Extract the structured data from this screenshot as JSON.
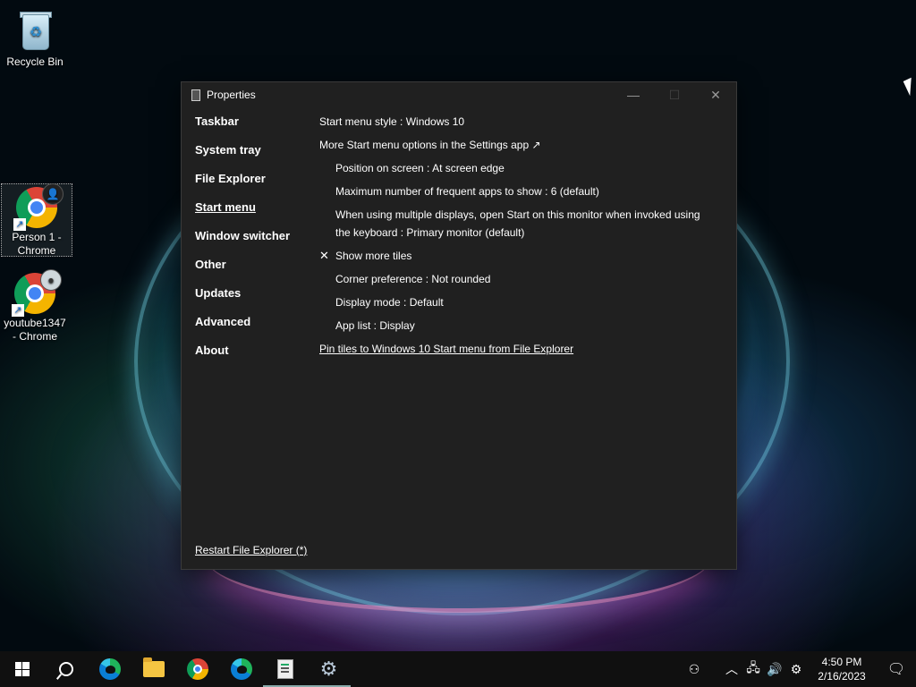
{
  "desktop": {
    "icons": [
      {
        "label": "Recycle Bin"
      },
      {
        "label": "Person 1 - Chrome"
      },
      {
        "label": "youtube1347 - Chrome"
      }
    ]
  },
  "window": {
    "title": "Properties",
    "controls": {
      "minimize": "—",
      "maximize": "☐",
      "close": "✕"
    },
    "nav": [
      {
        "label": "Taskbar"
      },
      {
        "label": "System tray"
      },
      {
        "label": "File Explorer"
      },
      {
        "label": "Start menu"
      },
      {
        "label": "Window switcher"
      },
      {
        "label": "Other"
      },
      {
        "label": "Updates"
      },
      {
        "label": "Advanced"
      },
      {
        "label": "About"
      }
    ],
    "content": {
      "start_menu_style": "Start menu style : Windows 10",
      "more_options_link": "More Start menu options in the Settings app ↗",
      "position": "Position on screen : At screen edge",
      "max_frequent": "Maximum number of frequent apps to show : 6 (default)",
      "multi_display": "When using multiple displays, open Start on this monitor when invoked using the keyboard : Primary monitor (default)",
      "show_more_tiles": "Show more tiles",
      "show_more_tiles_mark": "✕",
      "corner": "Corner preference : Not rounded",
      "display_mode": "Display mode : Default",
      "app_list": "App list : Display",
      "pin_tiles_link": "Pin tiles to Windows 10 Start menu from File Explorer"
    },
    "restart_link": "Restart File Explorer (*)"
  },
  "taskbar": {
    "time": "4:50 PM",
    "date": "2/16/2023",
    "tray_icons": [
      "people-icon",
      "chevron-up-icon",
      "network-icon",
      "volume-icon",
      "settings-gear-icon"
    ]
  }
}
